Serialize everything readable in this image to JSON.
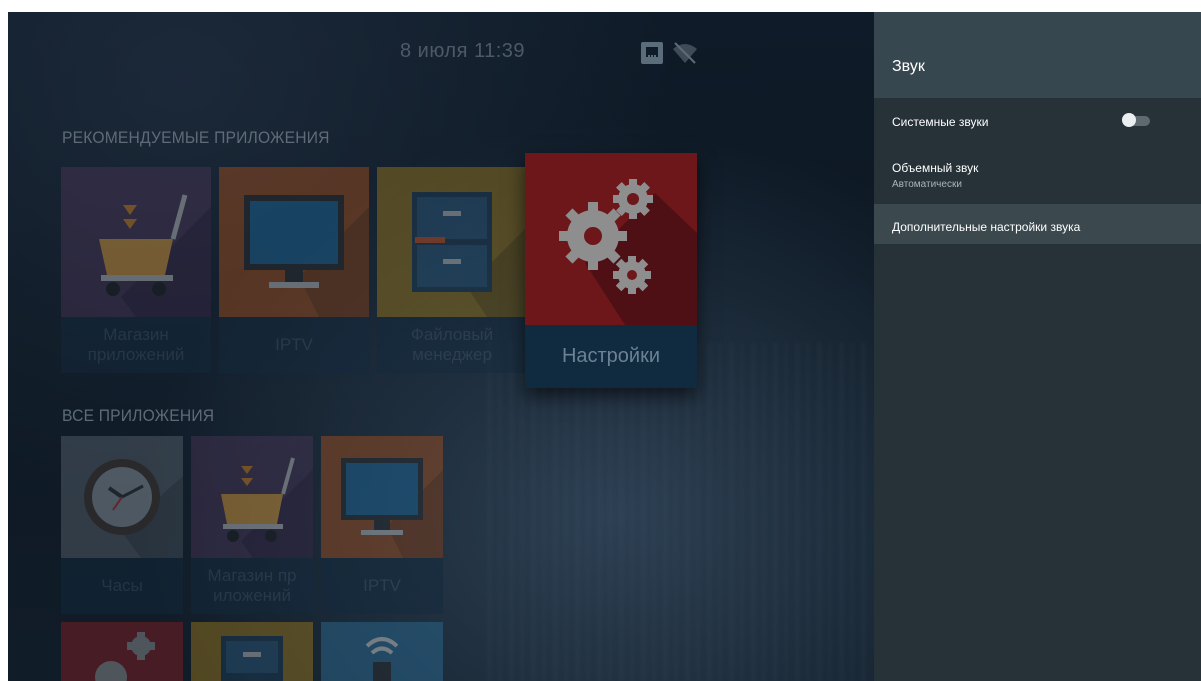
{
  "status_bar": {
    "datetime": "8 июля 11:39",
    "ethernet_icon": "ethernet-icon",
    "wifi_icon": "wifi-off-icon"
  },
  "home": {
    "recommended_title": "РЕКОМЕНДУЕМЫЕ ПРИЛОЖЕНИЯ",
    "recommended": [
      {
        "label": "Магазин приложений",
        "icon": "shopping-cart-icon",
        "color": "#4a3556"
      },
      {
        "label": "IPTV",
        "icon": "monitor-icon",
        "color": "#a8501b"
      },
      {
        "label": "Файловый менеджер",
        "icon": "file-cabinet-icon",
        "color": "#a07a19"
      },
      {
        "label": "Настройки",
        "icon": "gears-icon",
        "color": "#8b1d22"
      }
    ],
    "all_title": "ВСЕ ПРИЛОЖЕНИЯ",
    "all_apps": [
      {
        "label": "Часы",
        "icon": "clock-icon",
        "color": "#5b6670"
      },
      {
        "label": "Магазин пр иложений",
        "icon": "shopping-cart-icon",
        "color": "#4a3556"
      },
      {
        "label": "IPTV",
        "icon": "monitor-icon",
        "color": "#a8501b"
      }
    ],
    "partial_row_icons": [
      "gears-icon",
      "file-cabinet-icon",
      "wifi-router-icon"
    ]
  },
  "panel": {
    "title": "Звук",
    "items": [
      {
        "title": "Системные звуки",
        "toggle": "off"
      },
      {
        "title": "Объемный звук",
        "subtitle": "Автоматически"
      },
      {
        "title": "Дополнительные настройки звука",
        "selected": true
      }
    ]
  },
  "colors": {
    "panel_bg": "#263238",
    "panel_header": "#37474f",
    "selected_row": "#3b494f",
    "background": "#0c1622"
  }
}
